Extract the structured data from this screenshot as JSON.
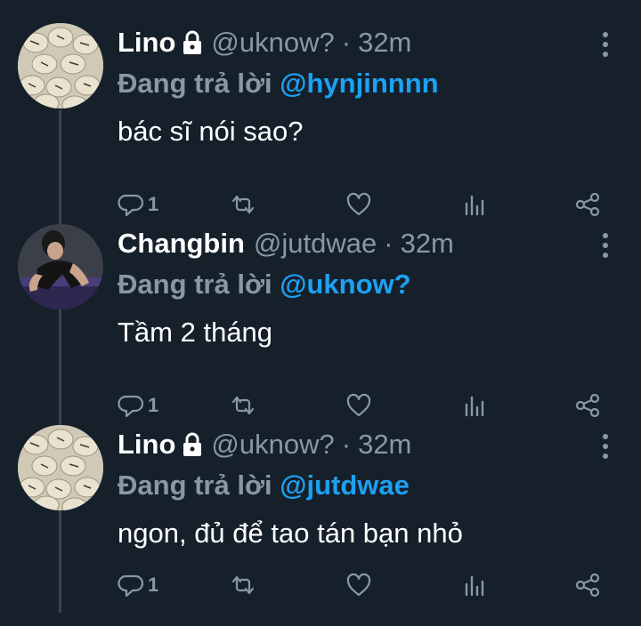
{
  "tweets": [
    {
      "name": "Lino",
      "locked": true,
      "handle": "@uknow?",
      "separator": "·",
      "time": "32m",
      "reply_prefix": "Đang trả lời",
      "reply_to": "@hynjinnnn",
      "text": "bác sĩ nói sao?",
      "reply_count": "1",
      "avatar": "hearts-avatar"
    },
    {
      "name": "Changbin",
      "locked": false,
      "handle": "@jutdwae",
      "separator": "·",
      "time": "32m",
      "reply_prefix": "Đang trả lời",
      "reply_to": "@uknow?",
      "text": "Tầm 2 tháng",
      "reply_count": "1",
      "avatar": "person-avatar"
    },
    {
      "name": "Lino",
      "locked": true,
      "handle": "@uknow?",
      "separator": "·",
      "time": "32m",
      "reply_prefix": "Đang trả lời",
      "reply_to": "@jutdwae",
      "text": "ngon, đủ để tao tán bạn nhỏ",
      "reply_count": "1",
      "avatar": "hearts-avatar"
    }
  ],
  "icons": {
    "reply": "comment-icon",
    "retweet": "retweet-icon",
    "like": "heart-icon",
    "analytics": "analytics-icon",
    "share": "share-icon",
    "more": "more-vertical-icon",
    "lock": "lock-icon"
  },
  "colors": {
    "background": "#15202b",
    "secondary_text": "#8899a6",
    "link": "#1da1f2",
    "thread_line": "#38444d"
  }
}
